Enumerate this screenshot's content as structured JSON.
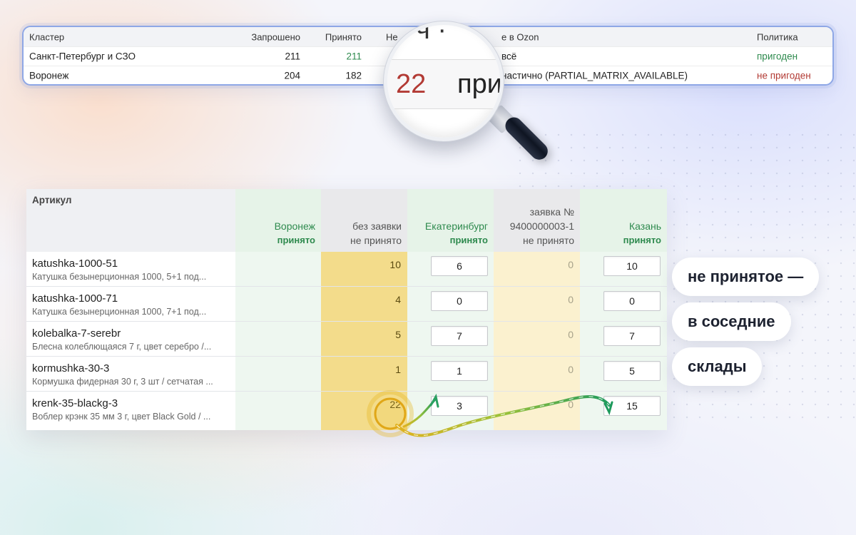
{
  "cluster_table": {
    "headers": {
      "cluster": "Кластер",
      "requested": "Запрошено",
      "accepted": "Принято",
      "not_accepted": "Не",
      "ozon": "е в Ozon",
      "policy": "Политика"
    },
    "rows": [
      {
        "cluster": "Санкт-Петербург и СЗО",
        "requested": "211",
        "accepted": "211",
        "ozon": "всё",
        "policy": "пригоден"
      },
      {
        "cluster": "Воронеж",
        "requested": "204",
        "accepted": "182",
        "ozon": "настично (PARTIAL_MATRIX_AVAILABLE)",
        "policy": "не пригоден"
      }
    ]
  },
  "magnifier": {
    "number": "22",
    "text": "при"
  },
  "main_table": {
    "headers": {
      "article": "Артикул",
      "voronezh": {
        "name": "Воронеж",
        "status": "принято"
      },
      "no_request": {
        "name": "без заявки",
        "status": "не принято"
      },
      "ekaterinburg": {
        "name": "Екатеринбург",
        "status": "принято"
      },
      "request_no": {
        "name1": "заявка №",
        "name2": "9400000003-1",
        "status": "не принято"
      },
      "kazan": {
        "name": "Казань",
        "status": "принято"
      }
    },
    "rows": [
      {
        "code": "katushka-1000-51",
        "desc": "Катушка безынерционная 1000, 5+1 под...",
        "no_request": "10",
        "ekaterinburg": "6",
        "request": "0",
        "kazan": "10"
      },
      {
        "code": "katushka-1000-71",
        "desc": "Катушка безынерционная 1000, 7+1 под...",
        "no_request": "4",
        "ekaterinburg": "0",
        "request": "0",
        "kazan": "0"
      },
      {
        "code": "kolebalka-7-serebr",
        "desc": "Блесна колеблющаяся 7 г, цвет серебро /...",
        "no_request": "5",
        "ekaterinburg": "7",
        "request": "0",
        "kazan": "7"
      },
      {
        "code": "kormushka-30-3",
        "desc": "Кормушка фидерная 30 г, 3 шт / сетчатая ...",
        "no_request": "1",
        "ekaterinburg": "1",
        "request": "0",
        "kazan": "5"
      },
      {
        "code": "krenk-35-blackg-3",
        "desc": "Воблер крэнк 35 мм 3 г, цвет Black Gold / ...",
        "no_request": "22",
        "ekaterinburg": "3",
        "request": "0",
        "kazan": "15"
      }
    ]
  },
  "callouts": [
    "не принятое —",
    "в соседние",
    "склады"
  ],
  "colors": {
    "green_text": "#2e8a4e",
    "red_text": "#b23a34",
    "accent_border": "#8ea7e6",
    "yellow_column": "#f3dc8b",
    "green_column": "#eef7f0"
  },
  "icons": [
    "magnifier-icon"
  ]
}
